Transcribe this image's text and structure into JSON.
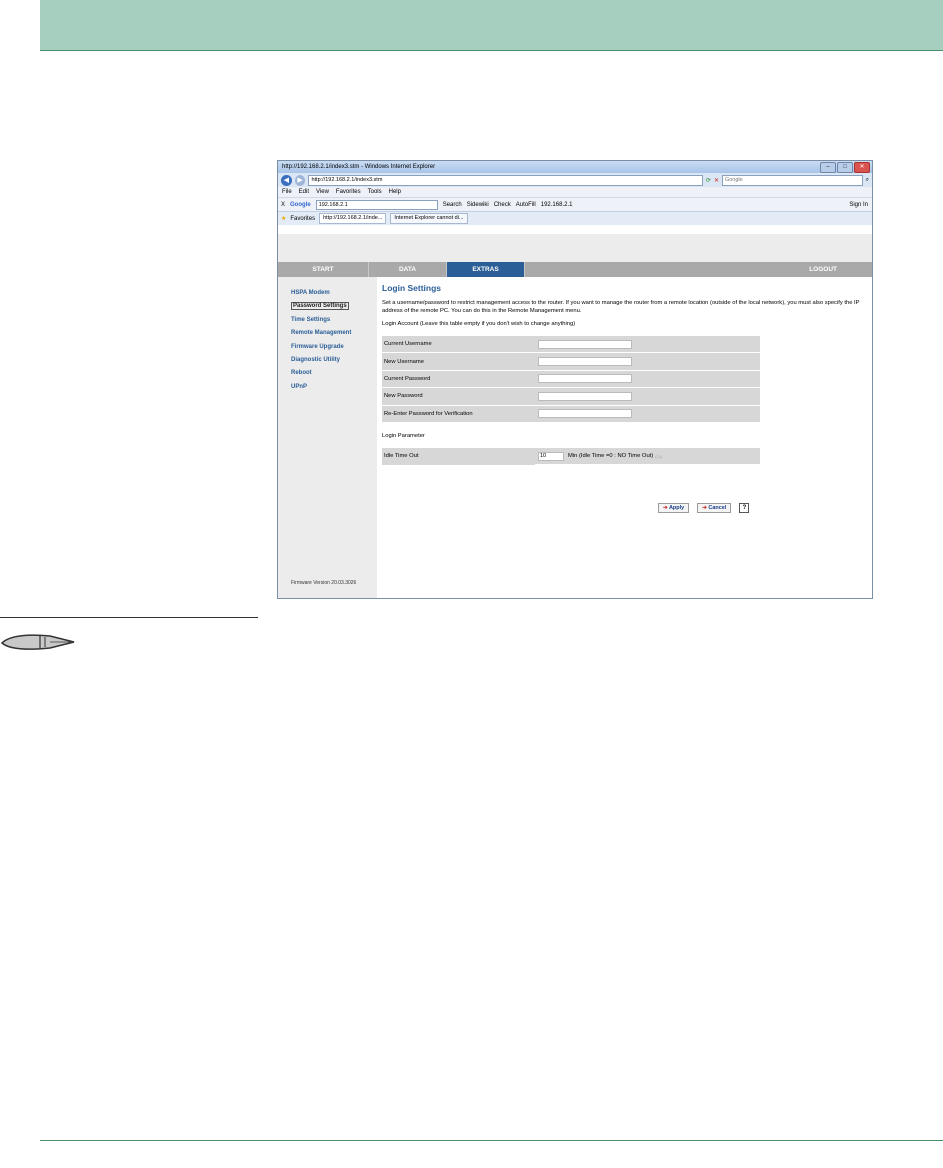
{
  "browser": {
    "title": "http://192.168.2.1/index3.stm - Windows Internet Explorer",
    "url": "http://192.168.2.1/index3.stm",
    "search_placeholder": "Google",
    "menu": [
      "File",
      "Edit",
      "View",
      "Favorites",
      "Tools",
      "Help"
    ],
    "google_toolbar": {
      "logo": "Google",
      "query": "192.168.2.1",
      "search": "Search",
      "sidewiki": "Sidewiki",
      "check": "Check",
      "autofill": "AutoFill",
      "link": "192.168.2.1",
      "sign_in": "Sign In"
    },
    "favorites_label": "Favorites",
    "tabs": [
      "http://192.168.2.1/inde...",
      "Internet Explorer cannot di..."
    ]
  },
  "router": {
    "nav": [
      "START",
      "DATA",
      "EXTRAS",
      "LOGOUT"
    ],
    "active_nav": "EXTRAS",
    "sidebar": [
      "HSPA Modem",
      "Password Settings",
      "Time Settings",
      "Remote Management",
      "Firmware Upgrade",
      "Diagnostic Utility",
      "Reboot",
      "UPnP"
    ],
    "active_sidebar": "Password Settings",
    "firmware": "Firmware Version 20.03.3026",
    "title": "Login Settings",
    "description": "Set a username/password to restrict management access to the router. If you want to manage the router from a remote location (outside of the local network), you must also specify the IP address of the remote PC. You can do this in the Remote Management menu.",
    "login_account": "Login Account (Leave this table empty if you don't wish to change anything)",
    "fields": [
      "Current Username",
      "New Username",
      "Current Password",
      "New Password",
      "Re-Enter Password for Verification"
    ],
    "login_parameter": "Login Parameter",
    "idle_label": "Idle Time Out",
    "idle_value": "10",
    "idle_hint": "Min (Idle Time =0 : NO Time Out)",
    "idle_tiny": "(10)",
    "apply": "Apply",
    "cancel": "Cancel",
    "help": "?"
  }
}
